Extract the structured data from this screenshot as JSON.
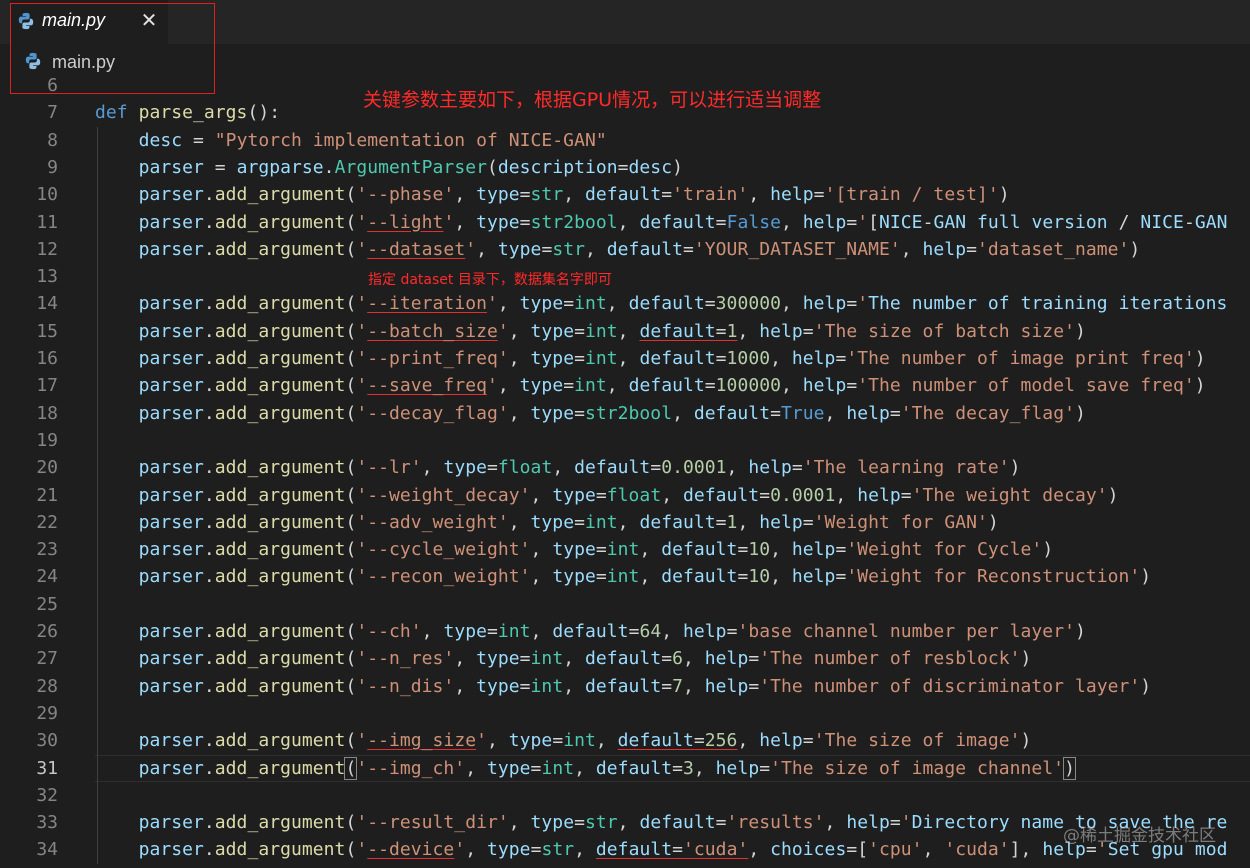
{
  "tab": {
    "label": "main.py",
    "close_glyph": "✕",
    "icon": "python-file-icon"
  },
  "breadcrumb": {
    "label": "main.py",
    "icon": "python-file-icon"
  },
  "annotations": {
    "top": "关键参数主要如下，根据GPU情况，可以进行适当调整",
    "dataset_note": "指定 dataset 目录下，数据集名字即可"
  },
  "watermark": "@稀土掘金技术社区",
  "colors": {
    "keyword": "#569cd6",
    "function": "#dcdcaa",
    "variable": "#9cdcfe",
    "string": "#ce9178",
    "number": "#b5cea8",
    "class": "#4ec9b0",
    "annotation": "#ff2a2a",
    "background": "#1e1e1e"
  },
  "editor": {
    "line_numbers": [
      "6",
      "7",
      "8",
      "9",
      "10",
      "11",
      "12",
      "13",
      "14",
      "15",
      "16",
      "17",
      "18",
      "19",
      "20",
      "21",
      "22",
      "23",
      "24",
      "25",
      "26",
      "27",
      "28",
      "29",
      "30",
      "31",
      "32",
      "33",
      "34"
    ],
    "active_line": "31",
    "lines": [
      "",
      "def parse_args():",
      "    desc = \"Pytorch implementation of NICE-GAN\"",
      "    parser = argparse.ArgumentParser(description=desc)",
      "    parser.add_argument('--phase', type=str, default='train', help='[train / test]')",
      "    parser.add_argument('--light', type=str2bool, default=False, help='[NICE-GAN full version / NICE-GAN",
      "    parser.add_argument('--dataset', type=str, default='YOUR_DATASET_NAME', help='dataset_name')",
      "",
      "    parser.add_argument('--iteration', type=int, default=300000, help='The number of training iterations",
      "    parser.add_argument('--batch_size', type=int, default=1, help='The size of batch size')",
      "    parser.add_argument('--print_freq', type=int, default=1000, help='The number of image print freq')",
      "    parser.add_argument('--save_freq', type=int, default=100000, help='The number of model save freq')",
      "    parser.add_argument('--decay_flag', type=str2bool, default=True, help='The decay_flag')",
      "",
      "    parser.add_argument('--lr', type=float, default=0.0001, help='The learning rate')",
      "    parser.add_argument('--weight_decay', type=float, default=0.0001, help='The weight decay')",
      "    parser.add_argument('--adv_weight', type=int, default=1, help='Weight for GAN')",
      "    parser.add_argument('--cycle_weight', type=int, default=10, help='Weight for Cycle')",
      "    parser.add_argument('--recon_weight', type=int, default=10, help='Weight for Reconstruction')",
      "",
      "    parser.add_argument('--ch', type=int, default=64, help='base channel number per layer')",
      "    parser.add_argument('--n_res', type=int, default=6, help='The number of resblock')",
      "    parser.add_argument('--n_dis', type=int, default=7, help='The number of discriminator layer')",
      "",
      "    parser.add_argument('--img_size', type=int, default=256, help='The size of image')",
      "    parser.add_argument('--img_ch', type=int, default=3, help='The size of image channel')",
      "",
      "    parser.add_argument('--result_dir', type=str, default='results', help='Directory name to save the re",
      "    parser.add_argument('--device', type=str, default='cuda', choices=['cpu', 'cuda'], help='Set gpu mod"
    ],
    "underlined": {
      "5": [
        "--light"
      ],
      "6": [
        "--dataset"
      ],
      "8": [
        "--iteration"
      ],
      "9": [
        "--batch_size",
        "default=1"
      ],
      "11": [
        "--save_freq"
      ],
      "24": [
        "--img_size",
        "default=256"
      ],
      "28": [
        "--device",
        "default='cuda'"
      ]
    }
  }
}
